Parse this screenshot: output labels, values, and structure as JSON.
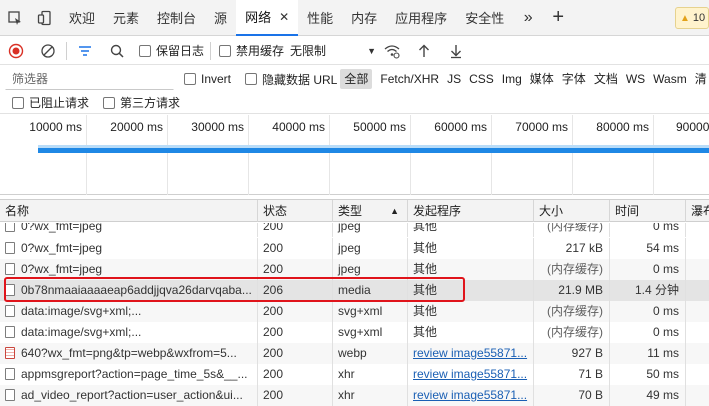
{
  "tabs": [
    {
      "label": "欢迎"
    },
    {
      "label": "元素"
    },
    {
      "label": "控制台"
    },
    {
      "label": "源"
    },
    {
      "label": "网络",
      "active": true
    },
    {
      "label": "性能"
    },
    {
      "label": "内存"
    },
    {
      "label": "应用程序"
    },
    {
      "label": "安全性"
    }
  ],
  "issues_badge": "10",
  "toolbar": {
    "preserve_log": "保留日志",
    "disable_cache": "禁用缓存",
    "throttling": "无限制"
  },
  "filter": {
    "placeholder": "筛选器",
    "invert": "Invert",
    "hide_data_urls": "隐藏数据 URL",
    "types": [
      "全部",
      "Fetch/XHR",
      "JS",
      "CSS",
      "Img",
      "媒体",
      "字体",
      "文档",
      "WS",
      "Wasm",
      "清"
    ],
    "blocked_requests": "已阻止请求",
    "third_party": "第三方请求"
  },
  "timeline": {
    "ticks": [
      "10000 ms",
      "20000 ms",
      "30000 ms",
      "40000 ms",
      "50000 ms",
      "60000 ms",
      "70000 ms",
      "80000 ms",
      "90000"
    ]
  },
  "table": {
    "columns": [
      "名称",
      "状态",
      "类型",
      "发起程序",
      "大小",
      "时间",
      "瀑布"
    ],
    "rows": [
      {
        "name": "0?wx_fmt=jpeg",
        "status": "200",
        "type": "jpeg",
        "initiator": "其他",
        "size": "(内存缓存)",
        "time": "0 ms",
        "icon": "file"
      },
      {
        "name": "0?wx_fmt=jpeg",
        "status": "200",
        "type": "jpeg",
        "initiator": "其他",
        "size": "217 kB",
        "time": "54 ms",
        "icon": "file"
      },
      {
        "name": "0?wx_fmt=jpeg",
        "status": "200",
        "type": "jpeg",
        "initiator": "其他",
        "size": "(内存缓存)",
        "time": "0 ms",
        "icon": "file"
      },
      {
        "name": "0b78nmaaiaaaaeap6addjjqva26darvqaba...",
        "status": "206",
        "type": "media",
        "initiator": "其他",
        "size": "21.9 MB",
        "time": "1.4 分钟",
        "icon": "file",
        "selected": true
      },
      {
        "name": "data:image/svg+xml;...",
        "status": "200",
        "type": "svg+xml",
        "initiator": "其他",
        "size": "(内存缓存)",
        "time": "0 ms",
        "icon": "file"
      },
      {
        "name": "data:image/svg+xml;...",
        "status": "200",
        "type": "svg+xml",
        "initiator": "其他",
        "size": "(内存缓存)",
        "time": "0 ms",
        "icon": "file"
      },
      {
        "name": "640?wx_fmt=png&tp=webp&wxfrom=5...",
        "status": "200",
        "type": "webp",
        "initiator": "review image55871...",
        "size": "927 B",
        "time": "11 ms",
        "icon": "img",
        "link": true
      },
      {
        "name": "appmsgreport?action=page_time_5s&__...",
        "status": "200",
        "type": "xhr",
        "initiator": "review image55871...",
        "size": "71 B",
        "time": "50 ms",
        "icon": "file",
        "link": true
      },
      {
        "name": "ad_video_report?action=user_action&ui...",
        "status": "200",
        "type": "xhr",
        "initiator": "review image55871...",
        "size": "70 B",
        "time": "49 ms",
        "icon": "file",
        "link": true
      }
    ]
  }
}
